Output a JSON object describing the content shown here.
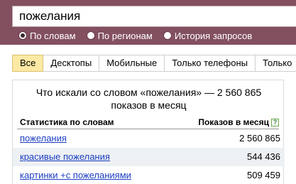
{
  "search": {
    "query": "пожелания",
    "modes": [
      {
        "label": "По словам",
        "checked": true
      },
      {
        "label": "По регионам",
        "checked": false
      },
      {
        "label": "История запросов",
        "checked": false
      }
    ]
  },
  "tabs": [
    "Все",
    "Десктопы",
    "Мобильные",
    "Только телефоны",
    "Только"
  ],
  "stats": {
    "summary_line1": "Что искали со словом «пожелания» — 2 560 865",
    "summary_line2": "показов в месяц",
    "col_query": "Статистика по словам",
    "col_count": "Показов в месяц",
    "help": "?",
    "rows": [
      {
        "query": "пожелания",
        "count": "2 560 865"
      },
      {
        "query": "красивые пожелания",
        "count": "544 436"
      },
      {
        "query": "картинки +с пожеланиями",
        "count": "509 459"
      }
    ]
  },
  "colors": {
    "panel": "#835060",
    "active_tab": "#fde9a3",
    "link": "#1a3dc1",
    "row_alt": "#eef1f4"
  }
}
